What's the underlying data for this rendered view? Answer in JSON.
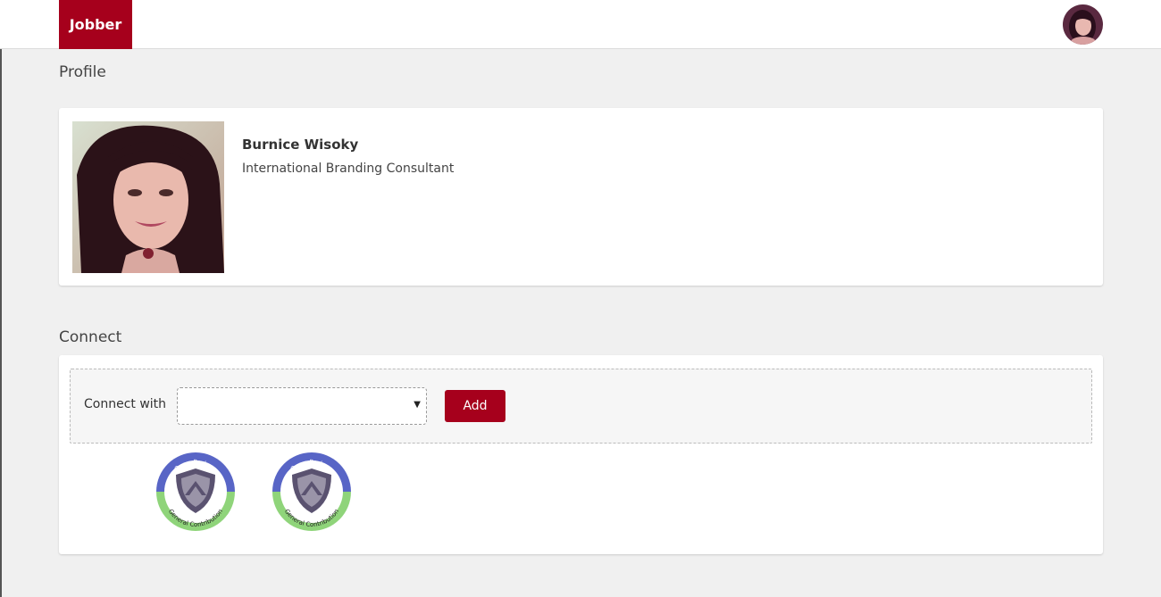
{
  "header": {
    "brand": "Jobber",
    "avatar_icon": "user-avatar-icon"
  },
  "profile": {
    "section_title": "Profile",
    "name": "Burnice Wisoky",
    "job_title": "International Branding Consultant"
  },
  "connect": {
    "section_title": "Connect",
    "label": "Connect with",
    "select_value": "",
    "add_label": "Add"
  },
  "badges": [
    {
      "top_text": "Open Badges",
      "bottom_text": "General Contribution"
    },
    {
      "top_text": "Open Badges",
      "bottom_text": "General Contribution"
    }
  ],
  "colors": {
    "brand": "#a6001c",
    "badge_blue": "#5865c6",
    "badge_green": "#8fd47a",
    "badge_shield": "#5a5270"
  }
}
